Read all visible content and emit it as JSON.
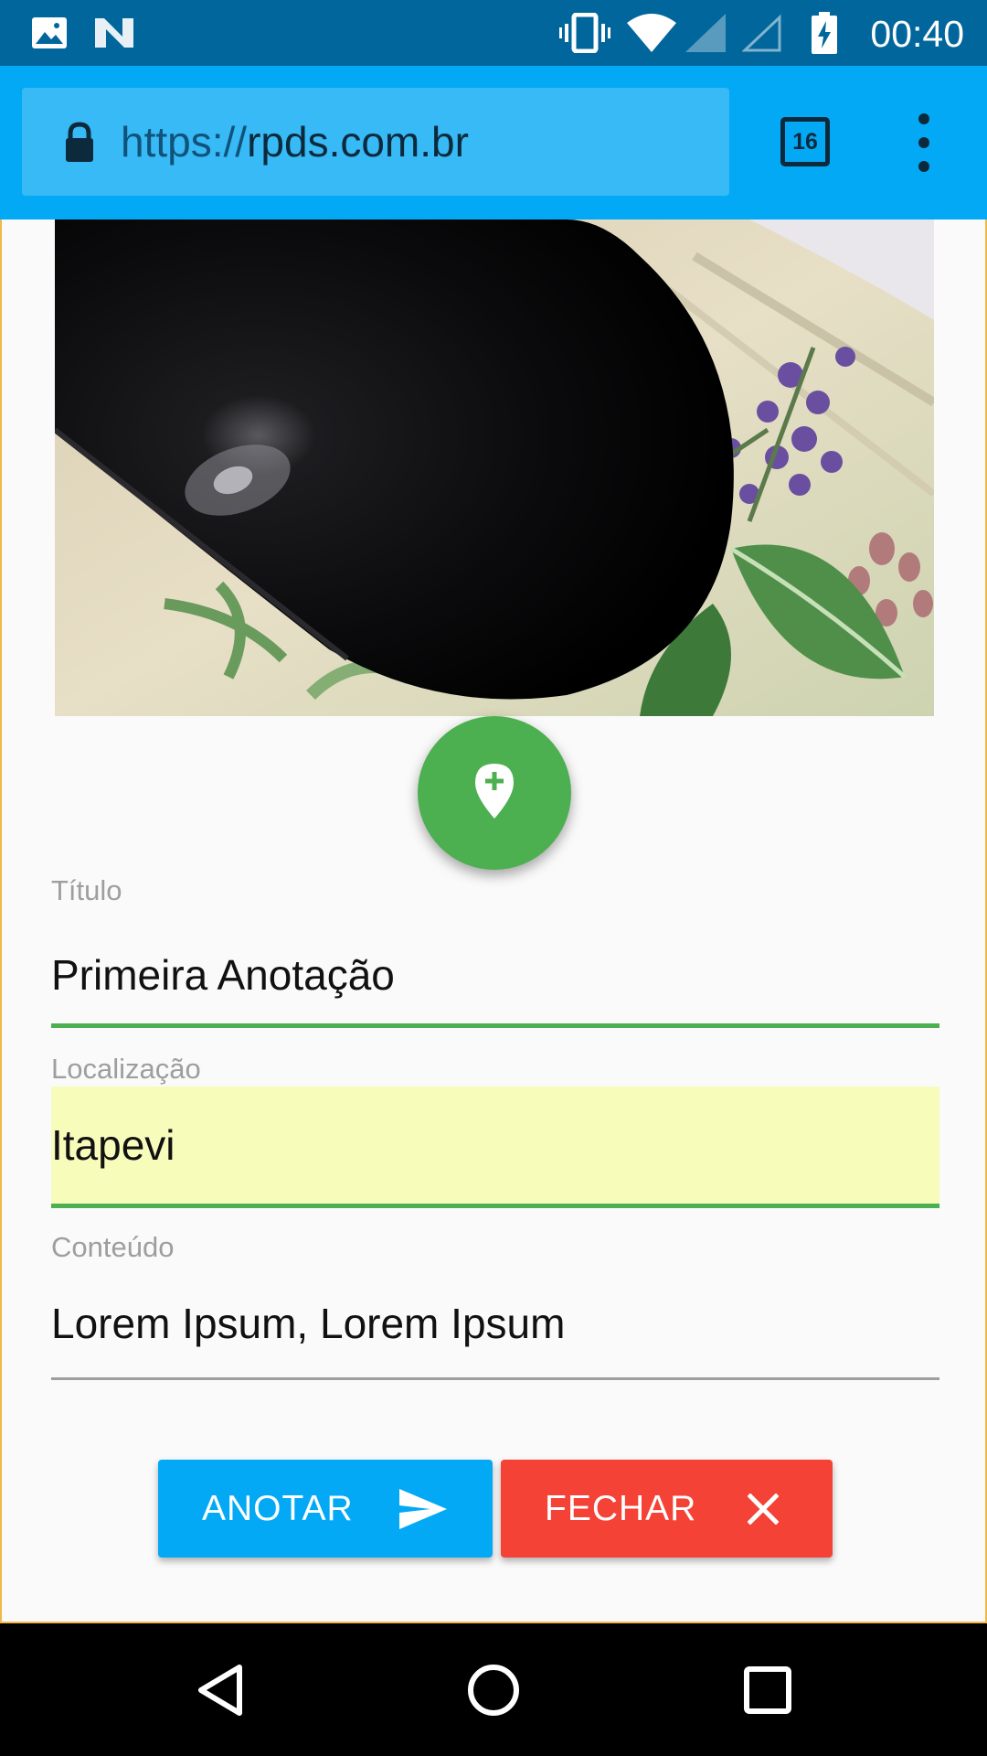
{
  "status_bar": {
    "time": "00:40",
    "icons": [
      "image-icon",
      "n-icon",
      "vibrate-icon",
      "wifi-icon",
      "signal-icon",
      "signal-empty-icon",
      "battery-charging-icon"
    ]
  },
  "browser": {
    "url_scheme": "https://",
    "url_host": "rpds.com.br",
    "tab_count": "16",
    "accent": "#03a9f4"
  },
  "form": {
    "titulo": {
      "label": "Título",
      "value": "Primeira Anotação"
    },
    "localizacao": {
      "label": "Localização",
      "value": "Itapevi"
    },
    "conteudo": {
      "label": "Conteúdo",
      "value": "Lorem Ipsum, Lorem Ipsum"
    }
  },
  "actions": {
    "anotar": {
      "label": "ANOTAR",
      "color": "#03a9f4",
      "icon": "send-icon"
    },
    "fechar": {
      "label": "FECHAR",
      "color": "#f44336",
      "icon": "close-icon"
    }
  },
  "fab": {
    "icon": "add-location-icon",
    "color": "#4caf50"
  },
  "nav_bar": {
    "icons": [
      "back-icon",
      "home-icon",
      "recents-icon"
    ]
  }
}
